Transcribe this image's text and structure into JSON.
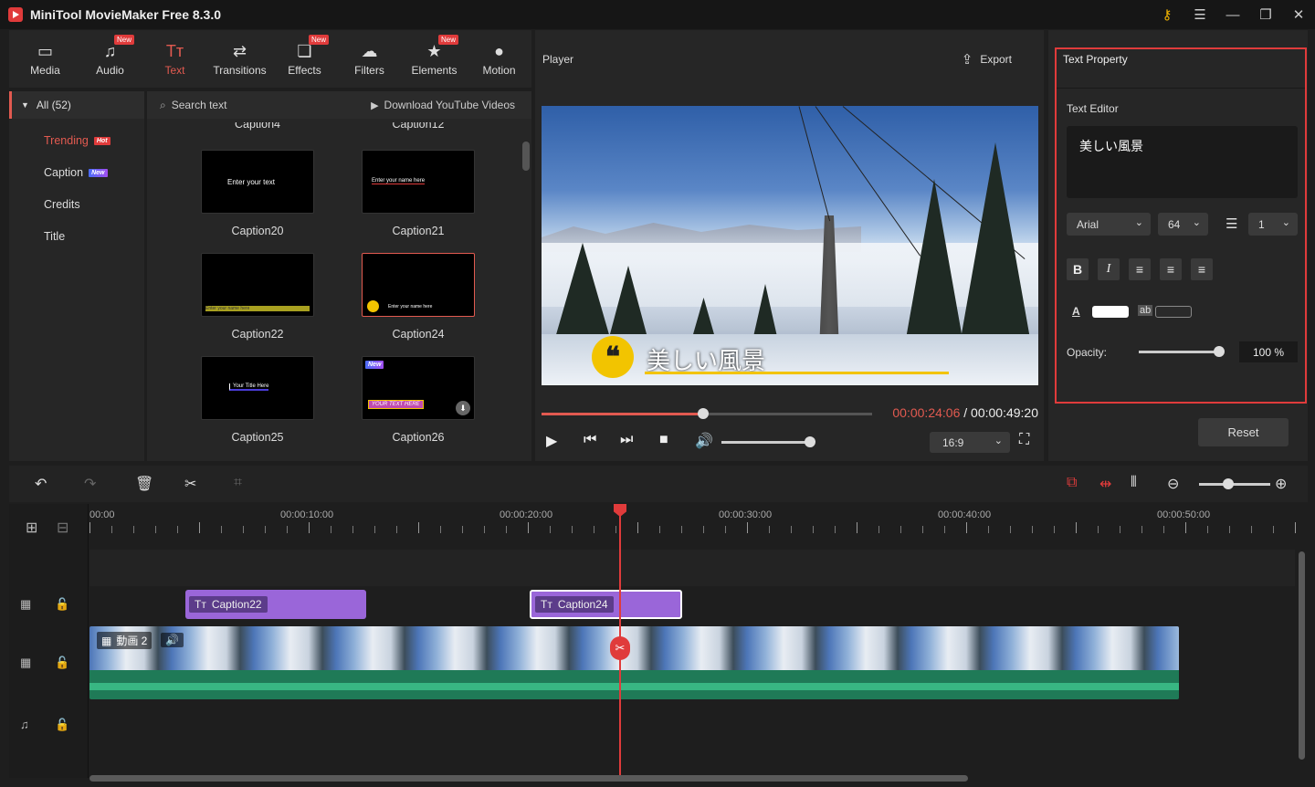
{
  "app": {
    "title": "MiniTool MovieMaker Free 8.3.0"
  },
  "toolbar": {
    "items": [
      {
        "label": "Media",
        "icon": "media-icon"
      },
      {
        "label": "Audio",
        "icon": "audio-icon",
        "badge": "New"
      },
      {
        "label": "Text",
        "icon": "text-icon"
      },
      {
        "label": "Transitions",
        "icon": "transitions-icon"
      },
      {
        "label": "Effects",
        "icon": "effects-icon",
        "badge": "New"
      },
      {
        "label": "Filters",
        "icon": "filters-icon"
      },
      {
        "label": "Elements",
        "icon": "elements-icon",
        "badge": "New"
      },
      {
        "label": "Motion",
        "icon": "motion-icon"
      }
    ]
  },
  "categories": {
    "all": "All (52)",
    "items": [
      {
        "label": "Trending",
        "badge": "Hot"
      },
      {
        "label": "Caption",
        "badge": "New"
      },
      {
        "label": "Credits"
      },
      {
        "label": "Title"
      }
    ]
  },
  "library": {
    "search": "Search text",
    "download": "Download YouTube Videos",
    "cut_labels": [
      "Caption4",
      "Caption12"
    ],
    "thumbs": [
      {
        "label": "Caption20",
        "text": "Enter your text"
      },
      {
        "label": "Caption21",
        "text": "Enter your name here"
      },
      {
        "label": "Caption22",
        "text": "Enter your name here"
      },
      {
        "label": "Caption24",
        "text": "Enter your name here"
      },
      {
        "label": "Caption25",
        "text": "Your Title Here"
      },
      {
        "label": "Caption26",
        "text": "YOUR TEXT HERE",
        "badge": "New"
      }
    ]
  },
  "player": {
    "title": "Player",
    "export": "Export",
    "caption": "美しい風景",
    "current": "00:00:24:06",
    "separator": " / ",
    "total": "00:00:49:20",
    "progress": 0.49,
    "ratio": "16:9"
  },
  "props": {
    "title": "Text Property",
    "editor_label": "Text Editor",
    "editor_text": "美しい風景",
    "font": "Arial",
    "size": "64",
    "line_spacing": "1",
    "format": [
      "B",
      "I"
    ],
    "bg_label": "ab",
    "text_color": "#ffffff",
    "opacity_label": "Opacity:",
    "opacity_value": "100 %",
    "reset": "Reset"
  },
  "timeline": {
    "ruler": [
      "00:00",
      "00:00:10:00",
      "00:00:20:00",
      "00:00:30:00",
      "00:00:40:00",
      "00:00:50:00"
    ],
    "text_clips": [
      {
        "label": "Caption22"
      },
      {
        "label": "Caption24"
      }
    ],
    "video_clip": "動画 2"
  }
}
